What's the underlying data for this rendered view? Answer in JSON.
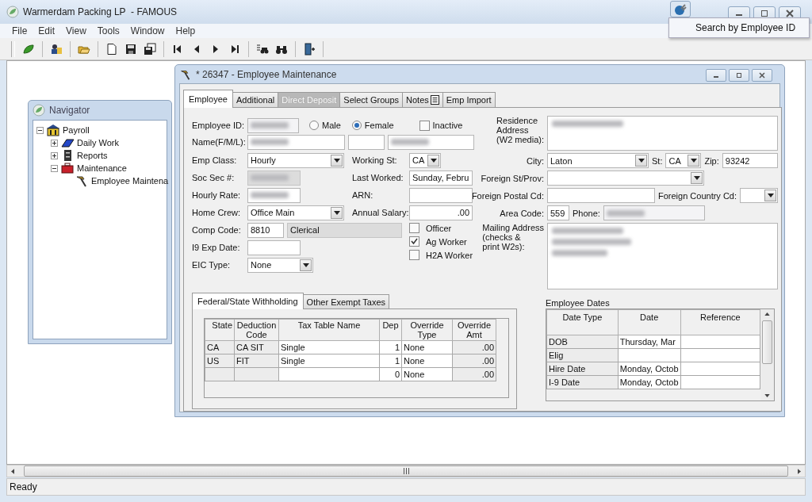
{
  "app": {
    "title": "Warmerdam Packing LP  - FAMOUS",
    "menu": [
      "File",
      "Edit",
      "View",
      "Tools",
      "Window",
      "Help"
    ],
    "tooltip": "Search by Employee ID",
    "status": "Ready"
  },
  "navigator": {
    "title": "Navigator",
    "tree": [
      {
        "label": "Payroll",
        "kind": "building",
        "expanded": true,
        "children": [
          {
            "label": "Daily Work",
            "kind": "book",
            "expanded": false
          },
          {
            "label": "Reports",
            "kind": "cabinet",
            "expanded": false
          },
          {
            "label": "Maintenance",
            "kind": "toolbox",
            "expanded": true,
            "children": [
              {
                "label": "Employee Maintena",
                "kind": "hammer"
              }
            ]
          }
        ]
      }
    ]
  },
  "employee_window": {
    "title": "* 26347 - Employee Maintenance",
    "tabs": [
      {
        "label": "Employee",
        "selected": true,
        "disabled": false,
        "icon": false
      },
      {
        "label": "Additional",
        "selected": false,
        "disabled": false,
        "icon": false
      },
      {
        "label": "Direct Deposit",
        "selected": false,
        "disabled": true,
        "icon": false
      },
      {
        "label": "Select Groups",
        "selected": false,
        "disabled": false,
        "icon": false
      },
      {
        "label": "Notes",
        "selected": false,
        "disabled": false,
        "icon": true
      },
      {
        "label": "Emp Import",
        "selected": false,
        "disabled": false,
        "icon": false
      }
    ]
  },
  "form": {
    "employee_id": {
      "label": "Employee ID:",
      "redacted": true
    },
    "gender": [
      {
        "label": "Male",
        "selected": false
      },
      {
        "label": "Female",
        "selected": true
      }
    ],
    "inactive": {
      "label": "Inactive",
      "checked": false
    },
    "name": {
      "label": "Name(F/M/L):",
      "parts": [
        {
          "redacted": true
        },
        {
          "redacted": false
        },
        {
          "redacted": true
        }
      ]
    },
    "left_fields": [
      {
        "kind": "dropdown",
        "label": "Emp Class:",
        "value": "Hourly"
      },
      {
        "kind": "text",
        "label": "Soc Sec #:",
        "redacted": true,
        "disabled": true
      },
      {
        "kind": "text",
        "label": "Hourly Rate:",
        "redacted": true,
        "disabled": false
      },
      {
        "kind": "dropdown",
        "label": "Home Crew:",
        "value": "Office Main"
      },
      {
        "kind": "code",
        "label": "Comp Code:",
        "value": "8810",
        "description": "Clerical"
      },
      {
        "kind": "text",
        "label": "I9 Exp Date:",
        "redacted": false,
        "disabled": false
      },
      {
        "kind": "combo",
        "label": "EIC Type:",
        "value": "None"
      }
    ],
    "middle_fields": [
      {
        "kind": "combo",
        "label": "Working St:",
        "value": "CA"
      },
      {
        "kind": "text",
        "label": "Last Worked:",
        "value": "Sunday, Febru"
      },
      {
        "kind": "text",
        "label": "ARN:"
      },
      {
        "kind": "number",
        "label": "Annual Salary:",
        "value": ".00"
      }
    ],
    "flags": [
      {
        "label": "Officer",
        "checked": false
      },
      {
        "label": "Ag Worker",
        "checked": true
      },
      {
        "label": "H2A Worker",
        "checked": false
      }
    ],
    "residence": {
      "label": "Residence\nAddress\n(W2 media):",
      "redacted": true
    },
    "city": {
      "label": "City:",
      "value": "Laton"
    },
    "state": {
      "label": "St:",
      "value": "CA"
    },
    "zip": {
      "label": "Zip:",
      "value": "93242"
    },
    "foreign_state": {
      "label": "Foreign St/Prov:"
    },
    "foreign_postal": {
      "label": "Foreign Postal Cd:"
    },
    "foreign_country": {
      "label": "Foreign Country Cd:"
    },
    "area_code": {
      "label": "Area Code:",
      "value": "559"
    },
    "phone": {
      "label": "Phone:",
      "redacted": true
    },
    "mailing": {
      "label": "Mailing Address\n(checks &\nprint W2s):",
      "redacted": true
    }
  },
  "withholding": {
    "tabs": [
      {
        "label": "Federal/State Withholding",
        "selected": true
      },
      {
        "label": "Other Exempt Taxes",
        "selected": false
      }
    ],
    "columns": [
      "State",
      "Deduction Code",
      "Tax Table Name",
      "Dep",
      "Override Type",
      "Override Amt"
    ],
    "rows": [
      [
        "CA",
        "CA SIT",
        "Single",
        "1",
        "None",
        ".00"
      ],
      [
        "US",
        "FIT",
        "Single",
        "1",
        "None",
        ".00"
      ],
      [
        null,
        null,
        null,
        "0",
        "None",
        ".00"
      ]
    ]
  },
  "employee_dates": {
    "title": "Employee Dates",
    "columns": [
      "Date Type",
      "Date",
      "Reference"
    ],
    "rows": [
      [
        "DOB",
        "Thursday, Mar",
        null
      ],
      [
        "Elig",
        null,
        null
      ],
      [
        "Hire Date",
        "Monday, Octob",
        null
      ],
      [
        "I-9 Date",
        "Monday, Octob",
        null
      ]
    ]
  }
}
